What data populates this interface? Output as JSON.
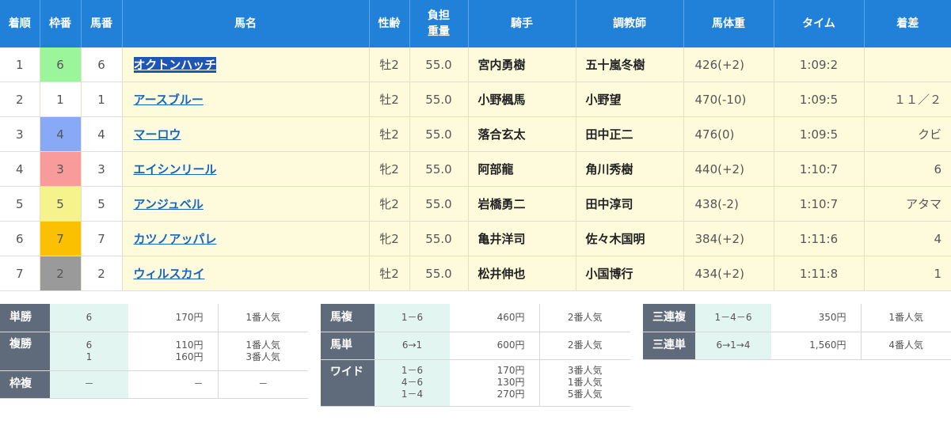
{
  "headers": {
    "rank": "着順",
    "frame": "枠番",
    "num": "馬番",
    "name": "馬名",
    "sexage": "性齢",
    "weight_l1": "負担",
    "weight_l2": "重量",
    "jockey": "騎手",
    "trainer": "調教師",
    "horse_weight": "馬体重",
    "time": "タイム",
    "margin": "着差"
  },
  "frame_colors": {
    "1": "#ffffff",
    "2": "#9a9a9a",
    "3": "#f99b9b",
    "4": "#88aaf6",
    "5": "#f7f38c",
    "6": "#9bf59b",
    "7": "#fbc000"
  },
  "rows": [
    {
      "rank": "1",
      "frame": "6",
      "num": "6",
      "name": "オクトンハッチ",
      "sexage": "牡2",
      "weight": "55.0",
      "jockey": "宮内勇樹",
      "trainer": "五十嵐冬樹",
      "horse_weight": "426(+2)",
      "time": "1:09:2",
      "margin": ""
    },
    {
      "rank": "2",
      "frame": "1",
      "num": "1",
      "name": "アースブルー",
      "sexage": "牡2",
      "weight": "55.0",
      "jockey": "小野楓馬",
      "trainer": "小野望",
      "horse_weight": "470(-10)",
      "time": "1:09:5",
      "margin": "１１／２"
    },
    {
      "rank": "3",
      "frame": "4",
      "num": "4",
      "name": "マーロウ",
      "sexage": "牡2",
      "weight": "55.0",
      "jockey": "落合玄太",
      "trainer": "田中正二",
      "horse_weight": "476(0)",
      "time": "1:09:5",
      "margin": "クビ"
    },
    {
      "rank": "4",
      "frame": "3",
      "num": "3",
      "name": "エイシンリール",
      "sexage": "牝2",
      "weight": "55.0",
      "jockey": "阿部龍",
      "trainer": "角川秀樹",
      "horse_weight": "440(+2)",
      "time": "1:10:7",
      "margin": "6"
    },
    {
      "rank": "5",
      "frame": "5",
      "num": "5",
      "name": "アンジュベル",
      "sexage": "牝2",
      "weight": "55.0",
      "jockey": "岩橋勇二",
      "trainer": "田中淳司",
      "horse_weight": "438(-2)",
      "time": "1:10:7",
      "margin": "アタマ"
    },
    {
      "rank": "6",
      "frame": "7",
      "num": "7",
      "name": "カツノアッパレ",
      "sexage": "牝2",
      "weight": "55.0",
      "jockey": "亀井洋司",
      "trainer": "佐々木国明",
      "horse_weight": "384(+2)",
      "time": "1:11:6",
      "margin": "4"
    },
    {
      "rank": "7",
      "frame": "2",
      "num": "2",
      "name": "ウィルスカイ",
      "sexage": "牡2",
      "weight": "55.0",
      "jockey": "松井伸也",
      "trainer": "小国博行",
      "horse_weight": "434(+2)",
      "time": "1:11:8",
      "margin": "1"
    }
  ],
  "payouts": {
    "left": [
      {
        "label": "単勝",
        "combos": [
          "6"
        ],
        "amounts": [
          "170円"
        ],
        "pops": [
          "1番人気"
        ]
      },
      {
        "label": "複勝",
        "combos": [
          "6",
          "1"
        ],
        "amounts": [
          "110円",
          "160円"
        ],
        "pops": [
          "1番人気",
          "3番人気"
        ]
      },
      {
        "label": "枠複",
        "combos": [
          "－"
        ],
        "amounts": [
          "－"
        ],
        "pops": [
          "－"
        ]
      }
    ],
    "middle": [
      {
        "label": "馬複",
        "combos": [
          "1－6"
        ],
        "amounts": [
          "460円"
        ],
        "pops": [
          "2番人気"
        ]
      },
      {
        "label": "馬単",
        "combos": [
          "6→1"
        ],
        "amounts": [
          "600円"
        ],
        "pops": [
          "2番人気"
        ]
      },
      {
        "label": "ワイド",
        "combos": [
          "1－6",
          "4－6",
          "1－4"
        ],
        "amounts": [
          "170円",
          "130円",
          "270円"
        ],
        "pops": [
          "3番人気",
          "1番人気",
          "5番人気"
        ]
      }
    ],
    "right": [
      {
        "label": "三連複",
        "combos": [
          "1－4－6"
        ],
        "amounts": [
          "350円"
        ],
        "pops": [
          "1番人気"
        ]
      },
      {
        "label": "三連単",
        "combos": [
          "6→1→4"
        ],
        "amounts": [
          "1,560円"
        ],
        "pops": [
          "4番人気"
        ]
      }
    ]
  }
}
